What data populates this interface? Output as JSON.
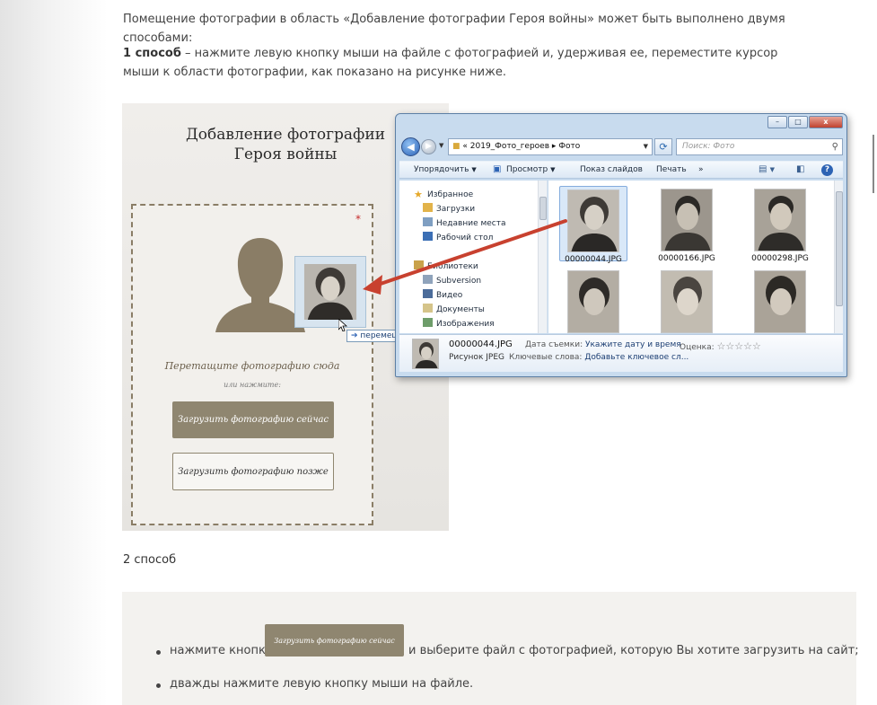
{
  "intro_text": "Помещение фотографии в область «Добавление фотографии Героя войны» может быть выполнено двумя способами:",
  "method1": {
    "label": "1 способ",
    "text": " – нажмите левую кнопку мыши на файле с фотографией и, удерживая ее, переместите курсор мыши к области фотографии, как показано на рисунке ниже."
  },
  "upload_panel": {
    "title_line1": "Добавление фотографии",
    "title_line2": "Героя войны",
    "required_mark": "*",
    "drop_hint": "Перетащите фотографию сюда",
    "or_hint": "или нажмите:",
    "upload_now": "Загрузить фотографию сейчас",
    "upload_later": "Загрузить фотографию позже",
    "drag_tooltip": "перемещение",
    "drag_tooltip_icon": "arrow-right-icon"
  },
  "explorer": {
    "window_buttons": [
      "–",
      "□",
      "x"
    ],
    "address_prefix": "«",
    "breadcrumb": [
      "2019_Фото_героев",
      "Фото"
    ],
    "breadcrumb_sep": "▸",
    "search_placeholder": "Поиск: Фото",
    "toolbar": {
      "organize": "Упорядочить",
      "view": "Просмотр",
      "slideshow": "Показ слайдов",
      "print": "Печать",
      "more": "»",
      "help": "?"
    },
    "nav": {
      "favorites": "Избранное",
      "favorites_items": [
        "Загрузки",
        "Недавние места",
        "Рабочий стол"
      ],
      "libraries": "Библиотеки",
      "libraries_items": [
        "Subversion",
        "Видео",
        "Документы",
        "Изображения"
      ]
    },
    "files": [
      {
        "name": "00000044.JPG",
        "selected": true
      },
      {
        "name": "00000166.JPG",
        "selected": false
      },
      {
        "name": "00000298.JPG",
        "selected": false
      },
      {
        "name": "",
        "selected": false
      },
      {
        "name": "",
        "selected": false
      },
      {
        "name": "",
        "selected": false
      }
    ],
    "details": {
      "filename": "00000044.JPG",
      "filetype": "Рисунок JPEG",
      "date_label": "Дата съемки:",
      "date_value": "Укажите дату и время",
      "rating_label": "Оценка:",
      "rating_stars": "☆☆☆☆☆",
      "keywords_label": "Ключевые слова:",
      "keywords_value": "Добавьте ключевое сл..."
    }
  },
  "method2": {
    "label": "2 способ",
    "item1_before": "нажмите кнопку",
    "item1_button": "Загрузить фотографию сейчас",
    "item1_after": "и выберите файл с фотографией, которую Вы хотите загрузить на сайт;",
    "item2": "дважды нажмите левую кнопку мыши на файле."
  },
  "colors": {
    "accent_brown": "#8f8670",
    "arrow_red": "#c8412f",
    "explorer_frame": "#c8dbee"
  }
}
